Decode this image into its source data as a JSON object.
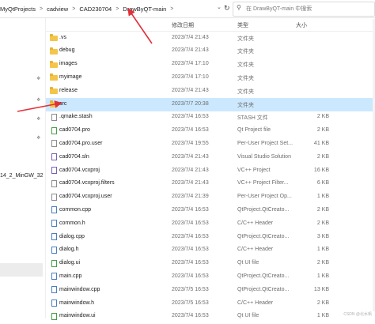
{
  "address_bar": {
    "breadcrumb": [
      "MyQtProjects",
      "cadview",
      "CAD230704",
      "DrawByQT-main"
    ],
    "separator": ">",
    "search_placeholder": "在 DrawByQT-main 中搜索"
  },
  "left_pane": {
    "visible_text": "14_2_MinGW_32"
  },
  "columns": {
    "date": "修改日期",
    "type": "类型",
    "size": "大小"
  },
  "files": [
    {
      "name": ".vs",
      "date": "2023/7/4 21:43",
      "type": "文件夹",
      "size": "",
      "icon": "folder-icon"
    },
    {
      "name": "debug",
      "date": "2023/7/4 21:43",
      "type": "文件夹",
      "size": "",
      "icon": "folder-icon"
    },
    {
      "name": "images",
      "date": "2023/7/4 17:10",
      "type": "文件夹",
      "size": "",
      "icon": "folder-icon"
    },
    {
      "name": "myimage",
      "date": "2023/7/4 17:10",
      "type": "文件夹",
      "size": "",
      "icon": "folder-icon"
    },
    {
      "name": "release",
      "date": "2023/7/4 21:43",
      "type": "文件夹",
      "size": "",
      "icon": "folder-icon"
    },
    {
      "name": "src",
      "date": "2023/7/7 20:38",
      "type": "文件夹",
      "size": "",
      "icon": "folder-icon",
      "selected": true
    },
    {
      "name": ".qmake.stash",
      "date": "2023/7/4 16:53",
      "type": "STASH 文件",
      "size": "2 KB",
      "icon": "file-icon"
    },
    {
      "name": "cad0704.pro",
      "date": "2023/7/4 16:53",
      "type": "Qt Project file",
      "size": "2 KB",
      "icon": "qt-project-icon"
    },
    {
      "name": "cad0704.pro.user",
      "date": "2023/7/4 19:55",
      "type": "Per-User Project Set...",
      "size": "41 KB",
      "icon": "file-icon"
    },
    {
      "name": "cad0704.sln",
      "date": "2023/7/4 21:43",
      "type": "Visual Studio Solution",
      "size": "2 KB",
      "icon": "vs-solution-icon"
    },
    {
      "name": "cad0704.vcxproj",
      "date": "2023/7/4 21:43",
      "type": "VC++ Project",
      "size": "16 KB",
      "icon": "vcxproj-icon"
    },
    {
      "name": "cad0704.vcxproj.filters",
      "date": "2023/7/4 21:43",
      "type": "VC++ Project Filter...",
      "size": "6 KB",
      "icon": "file-icon"
    },
    {
      "name": "cad0704.vcxproj.user",
      "date": "2023/7/4 21:39",
      "type": "Per-User Project Op...",
      "size": "1 KB",
      "icon": "file-icon"
    },
    {
      "name": "common.cpp",
      "date": "2023/7/4 16:53",
      "type": "QtProject.QtCreato...",
      "size": "2 KB",
      "icon": "cpp-file-icon"
    },
    {
      "name": "common.h",
      "date": "2023/7/4 16:53",
      "type": "C/C++ Header",
      "size": "2 KB",
      "icon": "header-file-icon"
    },
    {
      "name": "dialog.cpp",
      "date": "2023/7/4 16:53",
      "type": "QtProject.QtCreato...",
      "size": "3 KB",
      "icon": "cpp-file-icon"
    },
    {
      "name": "dialog.h",
      "date": "2023/7/4 16:53",
      "type": "C/C++ Header",
      "size": "1 KB",
      "icon": "header-file-icon"
    },
    {
      "name": "dialog.ui",
      "date": "2023/7/4 16:53",
      "type": "Qt UI file",
      "size": "2 KB",
      "icon": "ui-file-icon"
    },
    {
      "name": "main.cpp",
      "date": "2023/7/4 16:53",
      "type": "QtProject.QtCreato...",
      "size": "1 KB",
      "icon": "cpp-file-icon"
    },
    {
      "name": "mainwindow.cpp",
      "date": "2023/7/5 16:53",
      "type": "QtProject.QtCreato...",
      "size": "13 KB",
      "icon": "cpp-file-icon"
    },
    {
      "name": "mainwindow.h",
      "date": "2023/7/5 16:53",
      "type": "C/C++ Header",
      "size": "2 KB",
      "icon": "header-file-icon"
    },
    {
      "name": "mainwindow.ui",
      "date": "2023/7/4 16:53",
      "type": "Qt UI file",
      "size": "1 KB",
      "icon": "ui-file-icon"
    }
  ],
  "watermark": "CSDN @北水帆",
  "colors": {
    "selection": "#cce8ff",
    "folder": "#f3c64b",
    "annotation_arrow": "#e0303a"
  }
}
